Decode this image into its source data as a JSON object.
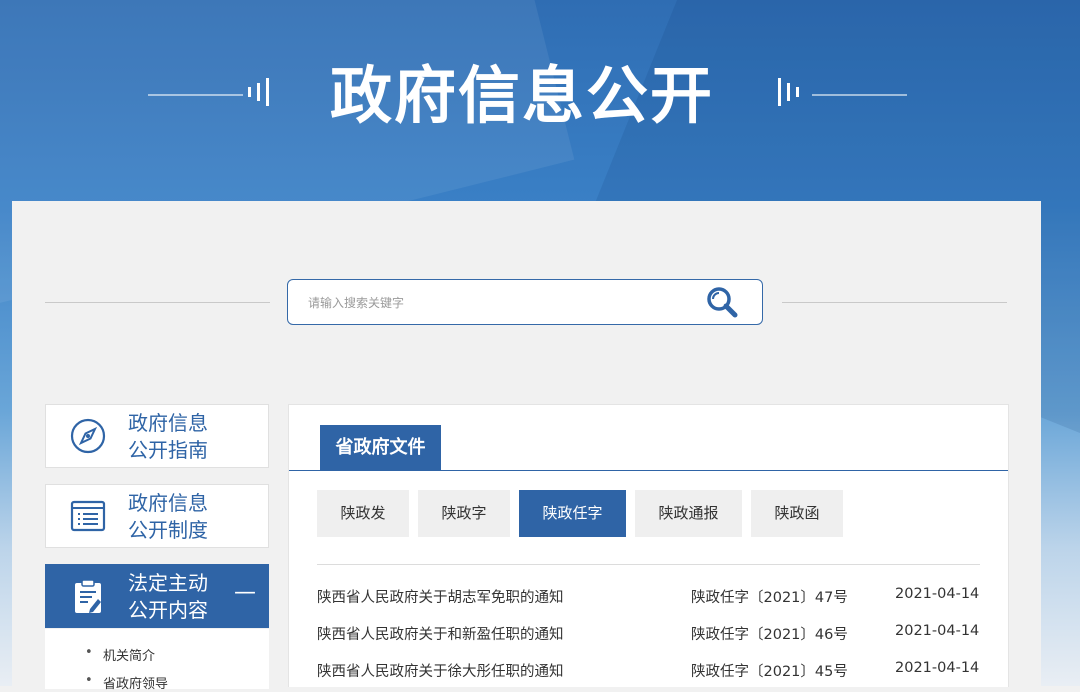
{
  "header": {
    "title": "政府信息公开"
  },
  "search": {
    "placeholder": "请输入搜索关键字"
  },
  "sidebar": {
    "items": [
      {
        "label_line1": "政府信息",
        "label_line2": "公开指南",
        "icon": "compass-icon"
      },
      {
        "label_line1": "政府信息",
        "label_line2": "公开制度",
        "icon": "document-list-icon"
      },
      {
        "label_line1": "法定主动",
        "label_line2": "公开内容",
        "icon": "clipboard-edit-icon",
        "toggle": "—"
      }
    ],
    "sub_items": [
      {
        "label": "机关简介"
      },
      {
        "label": "省政府领导"
      }
    ]
  },
  "content": {
    "section_tab": "省政府文件",
    "subtabs": [
      {
        "label": "陕政发"
      },
      {
        "label": "陕政字"
      },
      {
        "label": "陕政任字"
      },
      {
        "label": "陕政通报"
      },
      {
        "label": "陕政函"
      }
    ],
    "active_subtab": "陕政任字",
    "documents": [
      {
        "title": "陕西省人民政府关于胡志军免职的通知",
        "number": "陕政任字〔2021〕47号",
        "date": "2021-04-14"
      },
      {
        "title": "陕西省人民政府关于和新盈任职的通知",
        "number": "陕政任字〔2021〕46号",
        "date": "2021-04-14"
      },
      {
        "title": "陕西省人民政府关于徐大彤任职的通知",
        "number": "陕政任字〔2021〕45号",
        "date": "2021-04-14"
      }
    ]
  },
  "colors": {
    "brand_blue": "#2f64a6",
    "panel_bg": "#f1f1f1"
  }
}
